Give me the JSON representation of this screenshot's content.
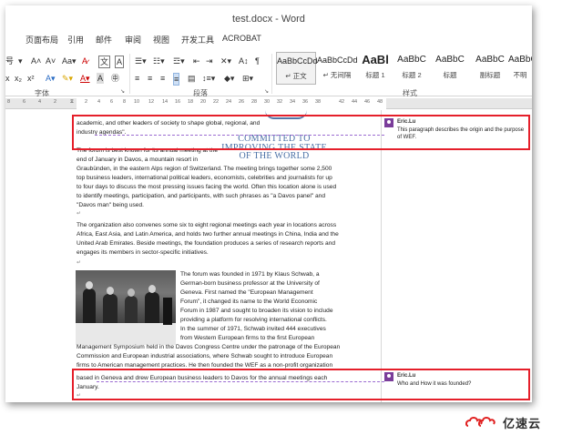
{
  "window": {
    "title": "test.docx - Word"
  },
  "tabs": [
    "页面布局",
    "引用",
    "邮件",
    "审阅",
    "视图",
    "开发工具",
    "ACROBAT"
  ],
  "ribbon": {
    "font_group_label": "字体",
    "paragraph_group_label": "段落",
    "styles_group_label": "样式",
    "font_size_fragment": "号",
    "styles": [
      {
        "preview": "AaBbCcDd",
        "name": "↵ 正文"
      },
      {
        "preview": "AaBbCcDd",
        "name": "↵ 无间隔"
      },
      {
        "preview": "AaBl",
        "name": "标题 1"
      },
      {
        "preview": "AaBbC",
        "name": "标题 2"
      },
      {
        "preview": "AaBbC",
        "name": "标题"
      },
      {
        "preview": "AaBbC",
        "name": "副标题"
      },
      {
        "preview": "AaBbC",
        "name": "不明"
      }
    ]
  },
  "ruler_numbers": [
    "8",
    "6",
    "4",
    "2",
    "2",
    "4",
    "6",
    "8",
    "10",
    "12",
    "14",
    "16",
    "18",
    "20",
    "22",
    "24",
    "26",
    "28",
    "30",
    "32",
    "34",
    "36",
    "38",
    "42",
    "44",
    "46",
    "48"
  ],
  "document": {
    "p1_line1": "academic, and other leaders of society to shape global, regional, and",
    "p1_line2": "industry agendas\".",
    "wef_logo": [
      "COMMITTED TO",
      "IMPROVING THE STATE",
      "OF THE WORLD"
    ],
    "p2_lines": [
      "The forum is best known for its annual meeting at the",
      "end of January in Davos, a mountain resort in",
      "Graubünden, in the eastern Alps region of Switzerland. The meeting brings together some 2,500",
      "top business leaders, international political leaders, economists, celebrities and journalists for up",
      "to four days to discuss the most pressing issues facing the world. Often this location alone is used",
      "to identify meetings, participation, and participants, with such phrases as \"a Davos panel\" and",
      "\"Davos man\" being used."
    ],
    "p3_lines": [
      "The organization also convenes some six to eight regional meetings each year in locations across",
      "Africa, East Asia, and Latin America, and holds two further annual meetings in China, India and the",
      "United Arab Emirates. Beside meetings, the foundation produces a series of research reports and",
      "engages its members in sector-specific initiatives."
    ],
    "p4_lines_right": [
      "The forum was founded in 1971 by Klaus Schwab, a",
      "German-born business professor at the University of",
      "Geneva. First named the \"European Management",
      "Forum\", it changed its name to the World Economic",
      "Forum in 1987 and sought to broaden its vision to include",
      "providing a platform for resolving international conflicts.",
      "In the summer of 1971, Schwab invited 444 executives",
      "from Western European firms to the first European"
    ],
    "p4_lines_full": [
      "Management Symposium held in the Davos Congress Centre under the patronage of the European",
      "Commission and European industrial associations, where Schwab sought to introduce European",
      "firms to American management practices. He then founded the WEF as a non-profit organization",
      "based in Geneva and drew European business leaders to Davos for the annual meetings each",
      "January."
    ]
  },
  "comments": [
    {
      "author": "Eric.Lu",
      "text": "This paragraph describes the origin and the purpose of WEF."
    },
    {
      "author": "Eric.Lu",
      "text": "Who and How it was founded?"
    }
  ],
  "watermark": {
    "text": "亿速云"
  },
  "colors": {
    "highlight": "#e51f2a",
    "comment_line": "#9b6bd1",
    "wef_text": "#4a6fa5",
    "avatar": "#7a3d9a"
  }
}
